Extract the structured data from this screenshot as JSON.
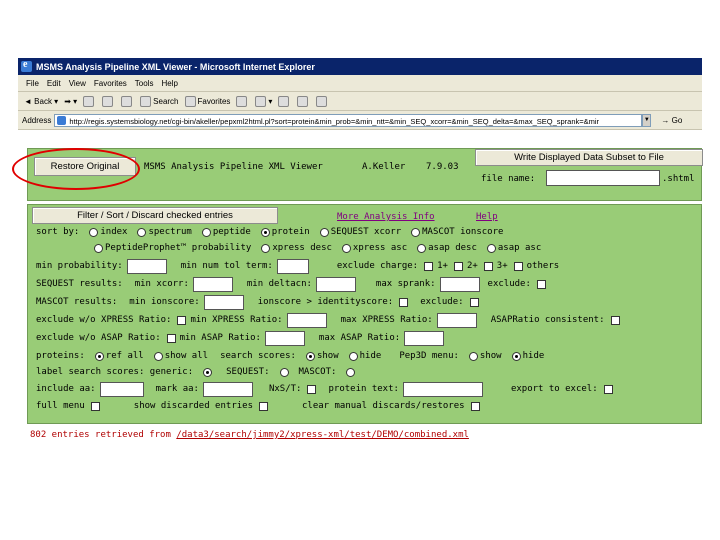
{
  "window": {
    "title": "MSMS Analysis Pipeline XML Viewer - Microsoft Internet Explorer"
  },
  "menu": [
    "File",
    "Edit",
    "View",
    "Favorites",
    "Tools",
    "Help"
  ],
  "toolbar": {
    "back": "Back",
    "search": "Search",
    "favorites": "Favorites"
  },
  "address": {
    "label": "Address",
    "url": "http://regis.systemsbiology.net/cgi-bin/akeller/pepxml2html.pl?sort=protein&min_prob=&min_ntt=&min_SEQ_xcorr=&min_SEQ_delta=&max_SEQ_sprank=&mir",
    "go": "Go"
  },
  "header": {
    "restore": "Restore Original",
    "title": "MSMS Analysis Pipeline XML Viewer",
    "author": "A.Keller",
    "version": "7.9.03",
    "write_button": "Write Displayed Data Subset to File",
    "file_label": "file name:",
    "file_ext": ".shtml"
  },
  "filter": {
    "button": "Filter / Sort / Discard checked entries",
    "more_link": "More Analysis Info",
    "help_link": "Help",
    "sortby": "sort by:",
    "sort_opts": [
      "index",
      "spectrum",
      "peptide",
      "protein",
      "SEQUEST xcorr",
      "MASCOT ionscore"
    ],
    "sort_opts2": [
      "PeptideProphet™ probability",
      "xpress desc",
      "xpress asc",
      "asap desc",
      "asap asc"
    ],
    "min_prob": "min probability:",
    "min_ntt": "min num tol term:",
    "excl_charge": "exclude charge:",
    "charges": [
      "1+",
      "2+",
      "3+",
      "others"
    ],
    "seq_results": "SEQUEST results:",
    "min_xcorr": "min xcorr:",
    "min_deltacn": "min deltacn:",
    "max_sprank": "max sprank:",
    "exclude": "exclude:",
    "mascot_results": "MASCOT results:",
    "min_ionscore": "min ionscore:",
    "ionscore_gt": "ionscore > identityscore:",
    "excl_xpress": "exclude w/o XPRESS Ratio:",
    "min_xpress": "min XPRESS Ratio:",
    "max_xpress": "max XPRESS Ratio:",
    "asap_consistent": "ASAPRatio consistent:",
    "excl_asap": "exclude w/o ASAP Ratio:",
    "min_asap": "min ASAP Ratio:",
    "max_asap": "max ASAP Ratio:",
    "proteins": "proteins:",
    "ref_all": "ref all",
    "show_all": "show all",
    "search_scores": "search scores:",
    "show": "show",
    "hide": "hide",
    "pep3d": "Pep3D menu:",
    "label_scores": "label search scores: generic:",
    "sequest": "SEQUEST:",
    "mascot": "MASCOT:",
    "include_aa": "include aa:",
    "mark_aa": "mark aa:",
    "nxst": "NxS/T:",
    "protein_text": "protein text:",
    "export": "export to excel:",
    "full_menu": "full menu",
    "show_discarded": "show discarded entries",
    "clear_manual": "clear manual discards/restores"
  },
  "status": {
    "prefix": "802 entries retrieved from ",
    "path": "/data3/search/jimmy2/xpress-xml/test/DEMO/combined.xml"
  }
}
